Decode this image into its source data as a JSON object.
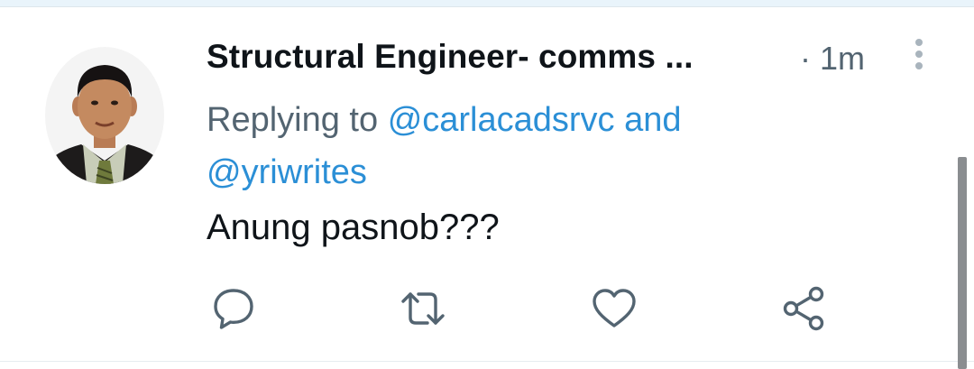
{
  "tweet": {
    "author_name": "Structural Engineer- comms ...",
    "time_separator": "·",
    "time": "1m",
    "replying_prefix": "Replying to",
    "mention_1": "@carlacadsrvc",
    "conjunction": "and",
    "mention_2": "@yriwrites",
    "text": "Anung pasnob???"
  },
  "icons": {
    "more": "more-vertical-icon",
    "reply": "reply-icon",
    "retweet": "retweet-icon",
    "like": "heart-icon",
    "share": "share-icon"
  },
  "colors": {
    "mention": "#2b8fd6",
    "secondary_text": "#536471",
    "primary_text": "#0f1419",
    "icon": "#536471"
  }
}
